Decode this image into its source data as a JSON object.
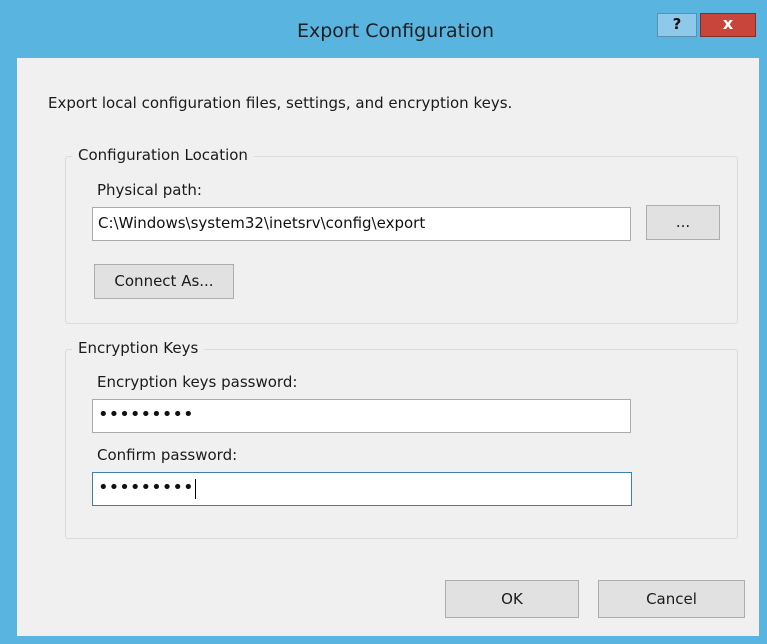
{
  "window": {
    "title": "Export Configuration",
    "help_label": "?",
    "close_label": "x"
  },
  "description": "Export local configuration files, settings, and encryption keys.",
  "config_location": {
    "legend": "Configuration Location",
    "physical_path_label": "Physical path:",
    "physical_path_value": "C:\\Windows\\system32\\inetsrv\\config\\export",
    "browse_label": "...",
    "connect_as_label": "Connect As..."
  },
  "encryption_keys": {
    "legend": "Encryption Keys",
    "password_label": "Encryption keys password:",
    "password_value": "•••••••••",
    "confirm_label": "Confirm password:",
    "confirm_value": "•••••••••"
  },
  "buttons": {
    "ok_label": "OK",
    "cancel_label": "Cancel"
  }
}
